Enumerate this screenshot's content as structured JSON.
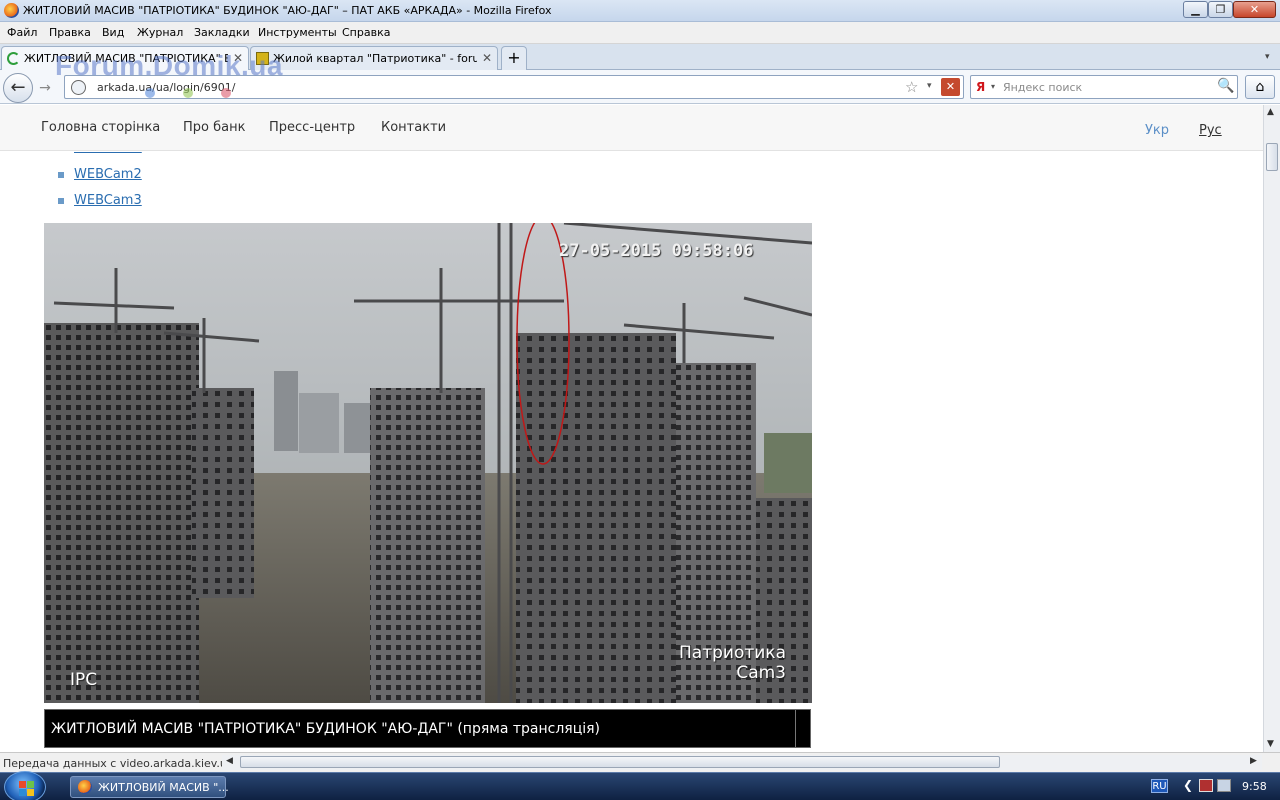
{
  "window": {
    "title": "ЖИТЛОВИЙ МАСИВ \"ПАТРІОТИКА\" БУДИНОК \"АЮ-ДАГ\" – ПАТ АКБ «АРКАДА» - Mozilla Firefox",
    "min_glyph": "▁",
    "max_glyph": "❐",
    "close_glyph": "✕"
  },
  "menubar": [
    "Файл",
    "Правка",
    "Вид",
    "Журнал",
    "Закладки",
    "Инструменты",
    "Справка"
  ],
  "tabs": [
    {
      "label": "ЖИТЛОВИЙ МАСИВ \"ПАТРІОТИКА\" БУД...",
      "close": "✕",
      "active": true
    },
    {
      "label": "Жилой квартал \"Патриотика\" - forum....",
      "close": "✕",
      "active": false
    }
  ],
  "newtab": "+",
  "tablist_arrow": "▾",
  "nav": {
    "back_glyph": "←",
    "forward_glyph": "→",
    "url": "arkada.ua/ua/login/6901/",
    "star": "☆",
    "dropdown": "▾",
    "stop": "✕"
  },
  "search": {
    "engine_icon": "Я",
    "dropdown": "▾",
    "placeholder": "Яндекс поиск",
    "button": "🔍"
  },
  "home_glyph": "⌂",
  "watermark": "Forum.Domik.ua",
  "site": {
    "nav": [
      "Головна сторінка",
      "Про банк",
      "Пресс-центр",
      "Контакти"
    ],
    "lang": [
      {
        "label": "Укр",
        "color": "#5b8fc7"
      },
      {
        "label": "Рус",
        "color": "#333333"
      }
    ],
    "cams": [
      "WEBCam1",
      "WEBCam2",
      "WEBCam3"
    ],
    "camera": {
      "timestamp": "27-05-2015 09:58:06",
      "name_line1": "Патриотика",
      "name_line2": "Cam3",
      "brand": "IPC",
      "annotation_color": "#c01818"
    },
    "caption": "ЖИТЛОВИЙ МАСИВ \"ПАТРІОТИКА\" БУДИНОК \"АЮ-ДАГ\" (пряма трансляція)"
  },
  "scroll": {
    "up": "▲",
    "down": "▼",
    "left": "◀",
    "right": "▶",
    "grip": "≡"
  },
  "status": "Передача данных с video.arkada.kiev.ua...",
  "taskbar": {
    "task_label": "ЖИТЛОВИЙ МАСИВ \"...",
    "lang": "RU",
    "tray_arrow": "❮",
    "clock": "9:58"
  },
  "colors": {
    "link": "#2a6db0",
    "active_lang": "#5b8fc7",
    "caption_bg": "#000000"
  }
}
